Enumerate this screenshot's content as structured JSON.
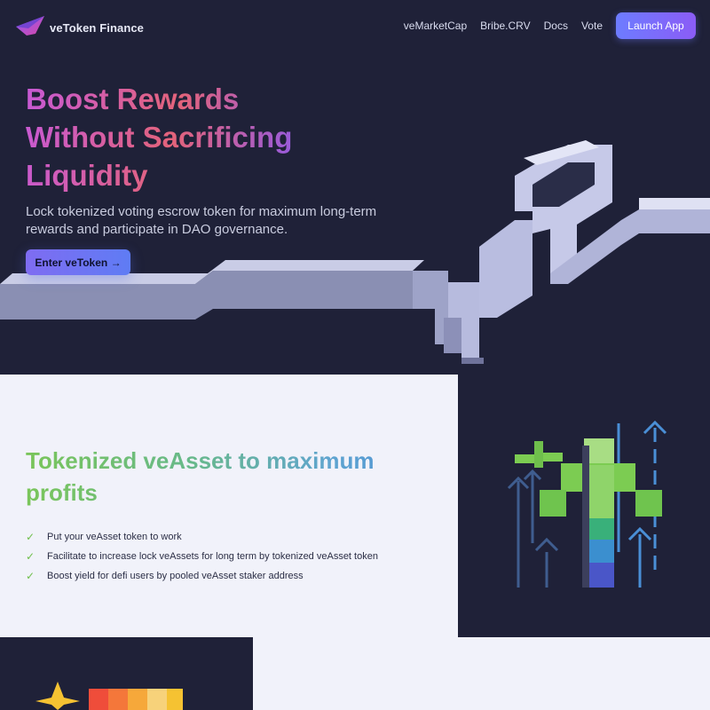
{
  "nav": {
    "brand_name": "veToken Finance",
    "brand_icon": "vetoken-logo-icon",
    "links": [
      "veMarketCap",
      "Bribe.CRV",
      "Docs",
      "Vote"
    ],
    "launch_label": "Launch App"
  },
  "hero": {
    "title_lines": [
      "Boost Rewards",
      "Without Sacrificing",
      "Liquidity"
    ],
    "subtitle": "Lock tokenized voting escrow token for maximum long-term rewards and participate in DAO governance.",
    "cta_label": "Enter veToken",
    "cta_icon": "arrow-right-icon",
    "art": "ve-letters-3d-illustration"
  },
  "section2": {
    "title_lines": [
      "Tokenized veAsset to maximum",
      "profits"
    ],
    "features": [
      "Put your veAsset token to work",
      "Facilitate to increase lock veAssets for long term by tokenized veAsset token",
      "Boost yield for defi users by pooled veAsset staker address"
    ],
    "feature_icon": "check-icon",
    "art": "plant-cross-arrows-illustration"
  },
  "section3": {
    "art": "star-and-bars-illustration"
  },
  "colors": {
    "background_dark": "#1f2138",
    "background_light": "#f1f2fa",
    "accent_purple": "#7b6bf0",
    "accent_green": "#7ac55a",
    "accent_blue": "#4b8fd6"
  }
}
